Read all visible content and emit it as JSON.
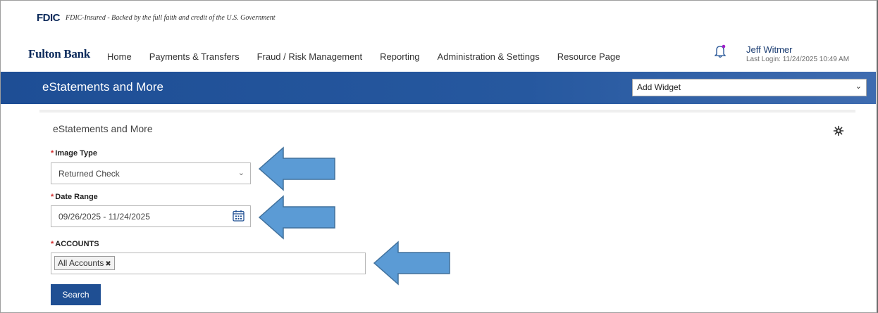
{
  "fdic": {
    "logo": "FDIC",
    "tagline": "FDIC-Insured - Backed by the full faith and credit of the U.S. Government"
  },
  "header": {
    "brand": "Fulton Bank",
    "nav": [
      "Home",
      "Payments & Transfers",
      "Fraud / Risk Management",
      "Reporting",
      "Administration & Settings",
      "Resource Page"
    ],
    "user_name": "Jeff Witmer",
    "last_login": "Last Login: 11/24/2025 10:49 AM"
  },
  "banner": {
    "title": "eStatements and More",
    "widget_select": "Add Widget"
  },
  "card": {
    "title": "eStatements and More",
    "image_type": {
      "label": "Image Type",
      "value": "Returned Check"
    },
    "date_range": {
      "label": "Date Range",
      "value": "09/26/2025 - 11/24/2025"
    },
    "accounts": {
      "label": "ACCOUNTS",
      "tag": "All Accounts"
    },
    "search_label": "Search",
    "required_mark": "*"
  },
  "colors": {
    "brand_blue": "#1e4e95",
    "arrow_fill": "#5b9bd5",
    "arrow_stroke": "#41719c",
    "required": "#d32f2f"
  }
}
